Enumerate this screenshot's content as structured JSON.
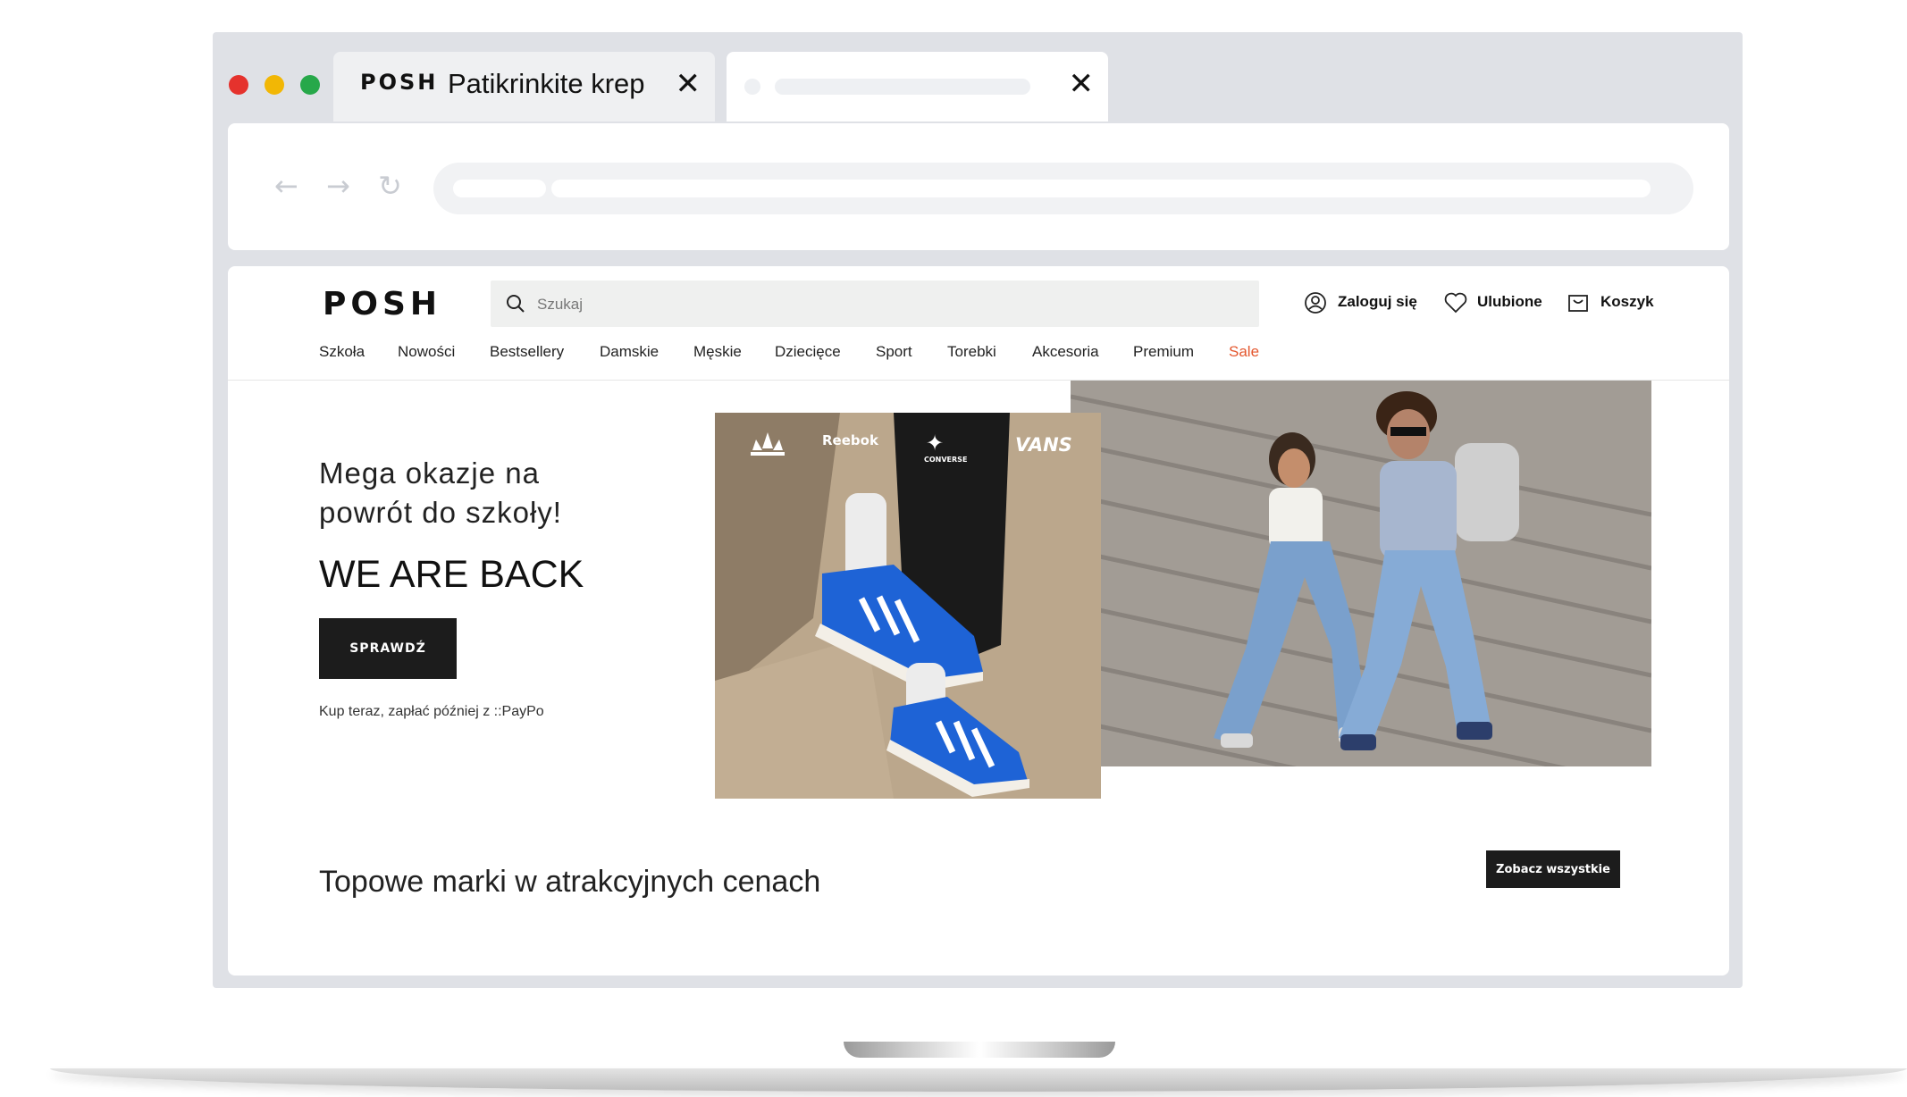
{
  "browser": {
    "window_controls": [
      "close-dot",
      "minimize-dot",
      "maximize-dot"
    ],
    "tabs": [
      {
        "logo": "POSH",
        "title": "Patikrinkite krep",
        "close": "✕"
      },
      {
        "close": "✕"
      }
    ],
    "nav_icons": [
      "back-arrow-icon",
      "forward-arrow-icon",
      "reload-icon"
    ]
  },
  "site": {
    "logo": "POSH",
    "search_placeholder": "Szukaj",
    "account": {
      "login": "Zaloguj się",
      "favorites": "Ulubione",
      "cart": "Koszyk"
    },
    "nav": [
      "Szkoła",
      "Nowości",
      "Bestsellery",
      "Damskie",
      "Męskie",
      "Dziecięce",
      "Sport",
      "Torebki",
      "Akcesoria",
      "Premium",
      "Sale"
    ],
    "hero": {
      "subtitle": "Mega okazje na powrót do szkoły!",
      "title": "WE ARE BACK",
      "cta": "SPRAWDŹ",
      "payment_note": "Kup teraz, zapłać później z ::PayPo",
      "brands": [
        "adidas-logo",
        "Reebok",
        "CONVERSE",
        "VANS"
      ]
    },
    "section": {
      "title": "Topowe marki w atrakcyjnych cenach",
      "see_all": "Zobacz wszystkie"
    }
  },
  "colors": {
    "frame": "#dfe1e6",
    "close_dot": "#e5322d",
    "minimize_dot": "#f2b705",
    "maximize_dot": "#27a84a",
    "sale": "#e4572e",
    "button_dark": "#1c1c1c",
    "sneaker_blue": "#1e63d6"
  }
}
